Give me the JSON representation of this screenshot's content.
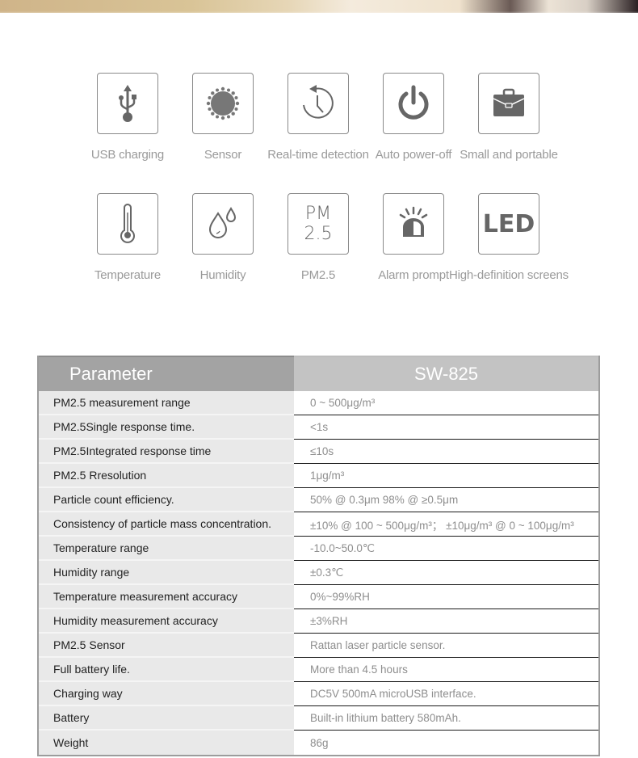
{
  "features": [
    {
      "icon": "usb-icon",
      "label": "USB charging"
    },
    {
      "icon": "sensor-icon",
      "label": "Sensor"
    },
    {
      "icon": "clock-history-icon",
      "label": "Real-time detection"
    },
    {
      "icon": "power-icon",
      "label": "Auto power-off"
    },
    {
      "icon": "briefcase-icon",
      "label": "Small and portable"
    },
    {
      "icon": "thermometer-icon",
      "label": "Temperature"
    },
    {
      "icon": "water-drops-icon",
      "label": "Humidity"
    },
    {
      "icon": "pm25-icon",
      "label": "PM2.5",
      "icon_text_line1": "PM",
      "icon_text_line2": "2.5"
    },
    {
      "icon": "alarm-light-icon",
      "label": "Alarm prompt"
    },
    {
      "icon": "led-icon",
      "label": "High-definition screens",
      "icon_text": "LED"
    }
  ],
  "spec_table": {
    "header": {
      "parameter": "Parameter",
      "model": "SW-825"
    },
    "rows": [
      {
        "parameter": "PM2.5 measurement range",
        "value": " 0 ~ 500μg/m³"
      },
      {
        "parameter": "PM2.5Single response time.",
        "value": "<1s"
      },
      {
        "parameter": "PM2.5Integrated response time",
        "value": "≤10s"
      },
      {
        "parameter": "PM2.5 Rresolution",
        "value": "1μg/m³"
      },
      {
        "parameter": "Particle count efficiency.",
        "value": "50% @ 0.3μm 98% @ ≥0.5μm"
      },
      {
        "parameter": "Consistency of particle mass concentration.",
        "value": "±10% @ 100 ~ 500μg/m³； ±10μg/m³ @ 0 ~ 100μg/m³"
      },
      {
        "parameter": "Temperature range",
        "value": "-10.0~50.0℃"
      },
      {
        "parameter": "Humidity range",
        "value": "±0.3℃"
      },
      {
        "parameter": "Temperature measurement accuracy",
        "value": "0%~99%RH"
      },
      {
        "parameter": "Humidity measurement accuracy",
        "value": "±3%RH"
      },
      {
        "parameter": "PM2.5 Sensor",
        "value": "Rattan laser particle sensor."
      },
      {
        "parameter": "Full battery life.",
        "value": "More than 4.5 hours"
      },
      {
        "parameter": "Charging way",
        "value": "DC5V 500mA microUSB interface."
      },
      {
        "parameter": "Battery",
        "value": "Built-in lithium battery 580mAh."
      },
      {
        "parameter": "Weight",
        "value": " 86g"
      }
    ]
  }
}
